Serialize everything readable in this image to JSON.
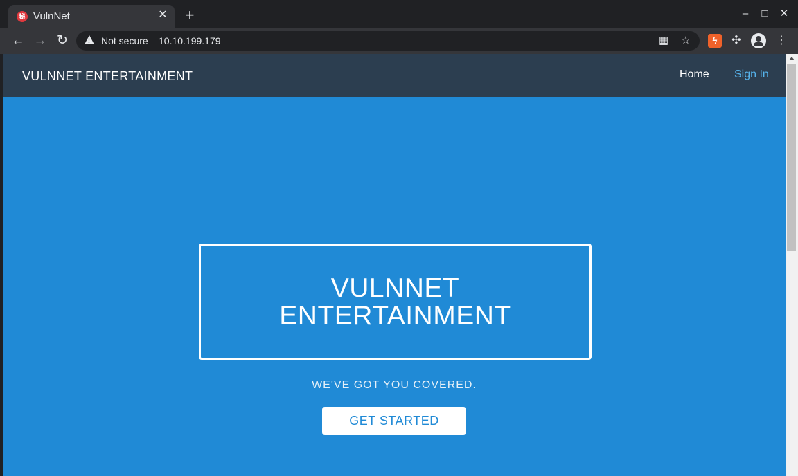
{
  "browser": {
    "tab": {
      "title": "VulnNet",
      "favicon_glyph": "秘",
      "close_glyph": "✕"
    },
    "new_tab_glyph": "+",
    "window_controls": {
      "minimize": "–",
      "maximize": "□",
      "close": "✕"
    },
    "nav": {
      "back": "←",
      "forward": "→",
      "reload": "↻"
    },
    "address": {
      "security_label": "Not secure",
      "url": "10.10.199.179"
    },
    "icons": {
      "omnibox": [
        "qr-code-icon",
        "star-icon"
      ],
      "extensions": [
        "extension-lightning-icon",
        "puzzle-icon",
        "avatar-icon",
        "kebab-menu-icon"
      ]
    },
    "glyphs": {
      "qr": "▦",
      "star": "☆",
      "lightning": "ϟ",
      "puzzle": "✣",
      "menu": "⋮"
    }
  },
  "site": {
    "navbar": {
      "brand": "VULNNET ENTERTAINMENT",
      "links": [
        {
          "label": "Home"
        },
        {
          "label": "Sign In"
        }
      ]
    },
    "hero": {
      "title_line1": "VULNNET",
      "title_line2": "ENTERTAINMENT",
      "tagline": "WE'VE GOT YOU COVERED.",
      "cta_label": "GET STARTED"
    }
  },
  "colors": {
    "chrome_dark": "#202124",
    "chrome_toolbar": "#35363a",
    "navbar_bg": "#2c3e50",
    "hero_bg": "#208ad6",
    "link_accent": "#56b4ed",
    "extension_orange": "#f0622a"
  }
}
